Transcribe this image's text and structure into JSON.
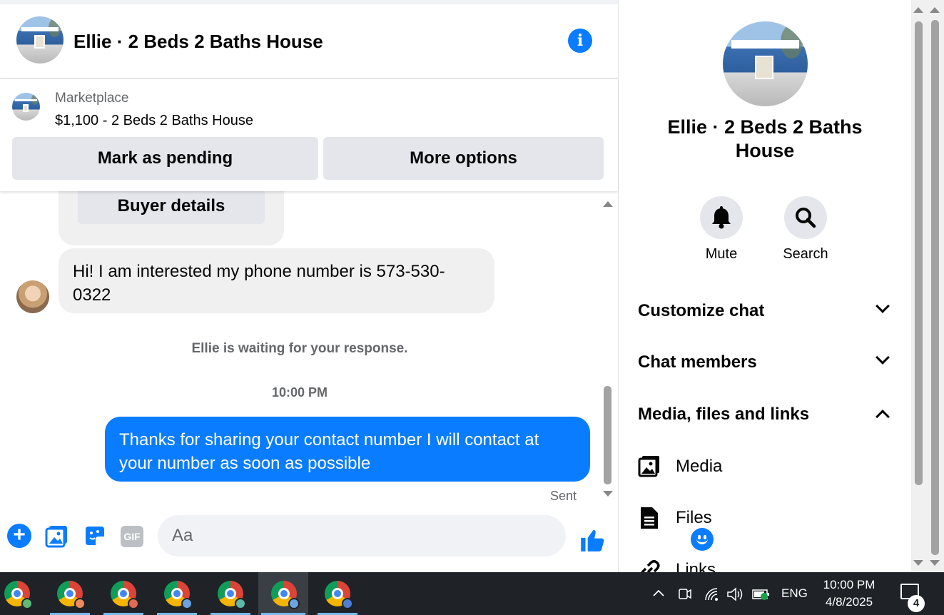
{
  "header": {
    "title": "Ellie · 2 Beds 2 Baths House",
    "info_icon": "info-icon"
  },
  "marketplace": {
    "label": "Marketplace",
    "listing": "$1,100 - 2 Beds 2 Baths House",
    "mark_pending_label": "Mark as pending",
    "more_options_label": "More options"
  },
  "messages": {
    "buyer_details_label": "Buyer details",
    "incoming": "Hi! I am interested my phone number is 573-530-0322",
    "waiting_notice": "Ellie is waiting for your response.",
    "timestamp": "10:00 PM",
    "outgoing": "Thanks for sharing your contact number I will contact at your number as soon as possible",
    "sent_status": "Sent"
  },
  "composer": {
    "placeholder": "Aa",
    "gif_label": "GIF",
    "icons": [
      "plus-icon",
      "photo-icon",
      "sticker-icon",
      "gif-icon",
      "emoji-icon",
      "thumbs-up-icon"
    ]
  },
  "panel": {
    "title": "Ellie · 2 Beds 2 Baths House",
    "mute_label": "Mute",
    "search_label": "Search",
    "sections": [
      {
        "label": "Customize chat",
        "expanded": false
      },
      {
        "label": "Chat members",
        "expanded": false
      },
      {
        "label": "Media, files and links",
        "expanded": true
      }
    ],
    "sub_items": [
      "Media",
      "Files",
      "Links"
    ]
  },
  "taskbar": {
    "apps": [
      "chrome-icon",
      "chrome-icon",
      "chrome-icon",
      "chrome-icon",
      "chrome-icon",
      "chrome-icon",
      "chrome-icon"
    ],
    "language": "ENG",
    "time": "10:00 PM",
    "date": "4/8/2025",
    "notification_count": "4"
  },
  "colors": {
    "accent": "#0a7cff",
    "bubble_in": "#f0f0f0",
    "button_gray": "#e4e6eb",
    "taskbar": "#1f2328"
  }
}
